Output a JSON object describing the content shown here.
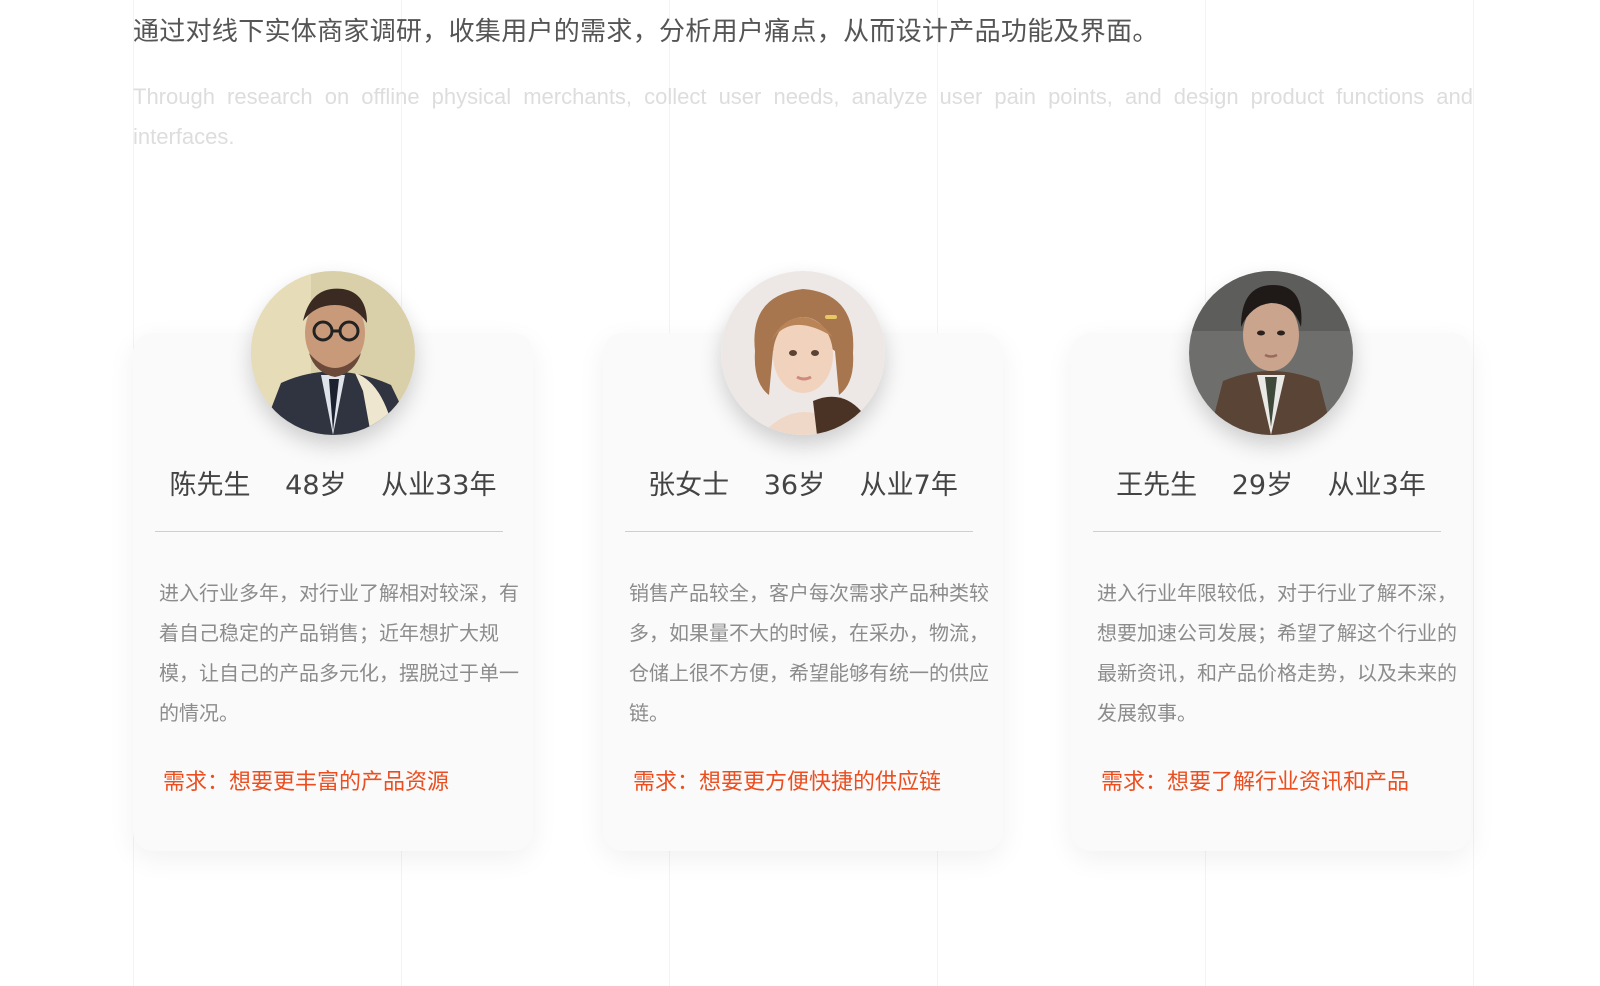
{
  "intro": {
    "zh": "通过对线下实体商家调研，收集用户的需求，分析用户痛点，从而设计产品功能及界面。",
    "en": "Through research on offline physical merchants, collect user needs, analyze user pain points, and design product functions and interfaces."
  },
  "personas": [
    {
      "name": "陈先生",
      "age": "48岁",
      "years": "从业33年",
      "description": "进入行业多年，对行业了解相对较深，有着自己稳定的产品销售；近年想扩大规模，让自己的产品多元化，摆脱过于单一的情况。",
      "need": "需求：想要更丰富的产品资源"
    },
    {
      "name": "张女士",
      "age": "36岁",
      "years": "从业7年",
      "description": "销售产品较全，客户每次需求产品种类较多，如果量不大的时候，在采办，物流，仓储上很不方便，希望能够有统一的供应链。",
      "need": "需求：想要更方便快捷的供应链"
    },
    {
      "name": "王先生",
      "age": "29岁",
      "years": "从业3年",
      "description": "进入行业年限较低，对于行业了解不深，想要加速公司发展；希望了解这个行业的最新资讯，和产品价格走势，以及未来的发展叙事。",
      "need": "需求：想要了解行业资讯和产品"
    }
  ],
  "colors": {
    "need_accent": "#ec4e1f",
    "card_background": "#fafafa",
    "description_text": "#8c8c8c"
  }
}
